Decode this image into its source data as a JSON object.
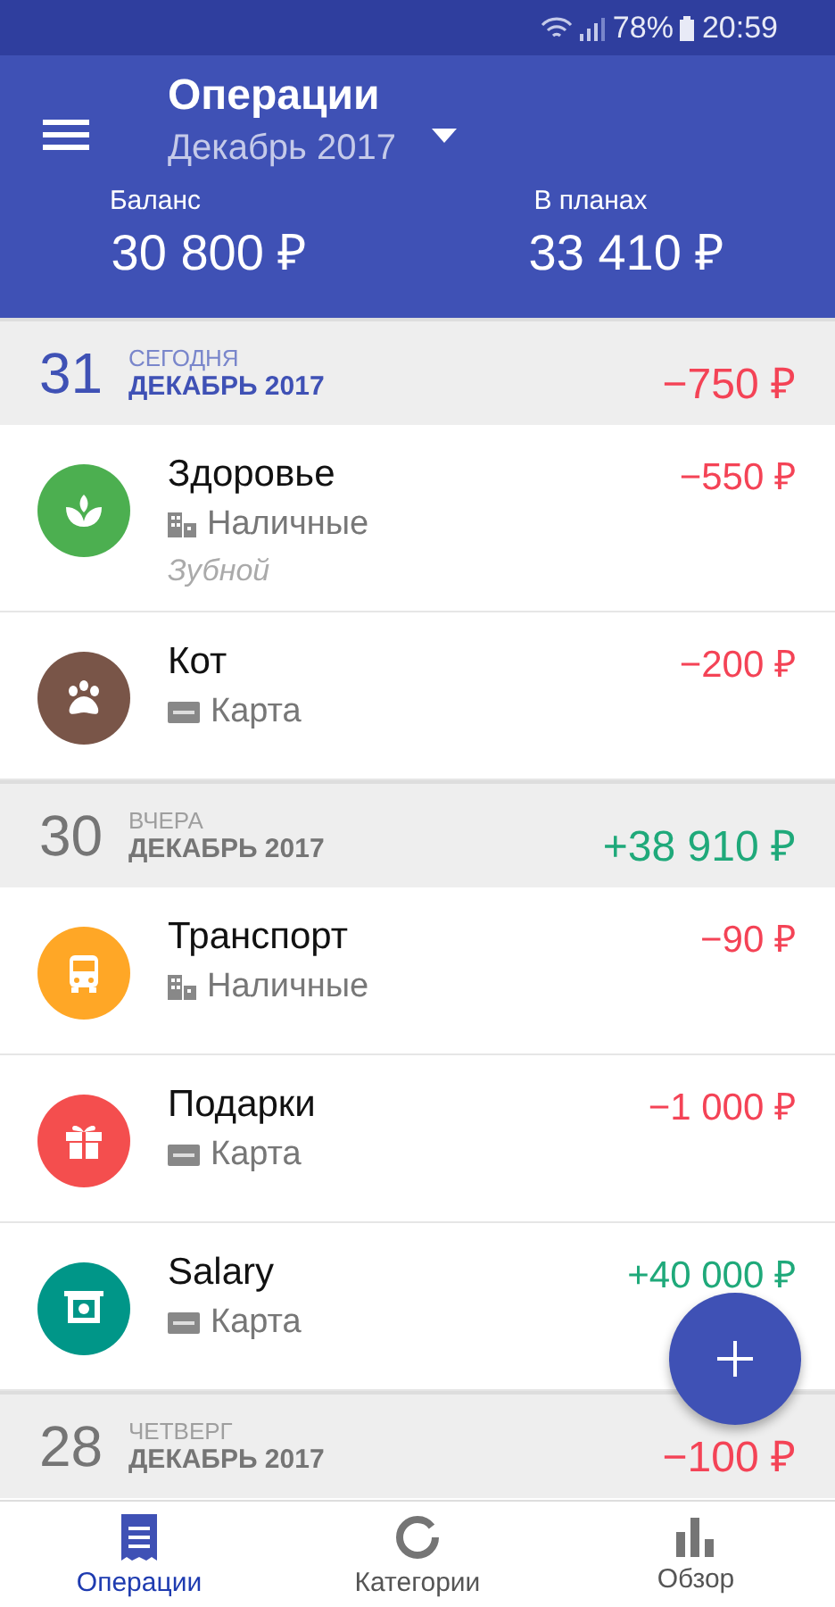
{
  "status_bar": {
    "battery": "78%",
    "time": "20:59"
  },
  "header": {
    "title": "Операции",
    "period": "Декабрь 2017",
    "balance": {
      "label": "Баланс",
      "value": "30 800 ₽"
    },
    "planned": {
      "label": "В планах",
      "value": "33 410 ₽"
    }
  },
  "days": [
    {
      "day": "31",
      "weekday": "СЕГОДНЯ",
      "month": "ДЕКАБРЬ 2017",
      "today": true,
      "total": "−750 ₽",
      "income": false,
      "operations": [
        {
          "kind": "health",
          "category": "Здоровье",
          "color": "#4caf50",
          "account": {
            "kind": "cash",
            "name": "Наличные"
          },
          "note": "Зубной",
          "amount": "−550 ₽",
          "income": false
        },
        {
          "kind": "pet",
          "category": "Кот",
          "color": "#795548",
          "account": {
            "kind": "card",
            "name": "Карта"
          },
          "amount": "−200 ₽",
          "income": false
        }
      ]
    },
    {
      "day": "30",
      "weekday": "ВЧЕРА",
      "month": "ДЕКАБРЬ 2017",
      "today": false,
      "total": "+38 910 ₽",
      "income": true,
      "operations": [
        {
          "kind": "transport",
          "category": "Транспорт",
          "color": "#ffa726",
          "account": {
            "kind": "cash",
            "name": "Наличные"
          },
          "amount": "−90 ₽",
          "income": false
        },
        {
          "kind": "gift",
          "category": "Подарки",
          "color": "#f44e4e",
          "account": {
            "kind": "card",
            "name": "Карта"
          },
          "amount": "−1 000 ₽",
          "income": false
        },
        {
          "kind": "salary",
          "category": "Salary",
          "color": "#009688",
          "account": {
            "kind": "card",
            "name": "Карта"
          },
          "amount": "+40 000 ₽",
          "income": true
        }
      ]
    },
    {
      "day": "28",
      "weekday": "ЧЕТВЕРГ",
      "month": "ДЕКАБРЬ 2017",
      "today": false,
      "total": "−100 ₽",
      "income": false
    }
  ],
  "nav": [
    {
      "kind": "list",
      "label": "Операции",
      "selected": true
    },
    {
      "kind": "ring",
      "label": "Категории",
      "selected": false
    },
    {
      "kind": "bars",
      "label": "Обзор",
      "selected": false
    }
  ]
}
